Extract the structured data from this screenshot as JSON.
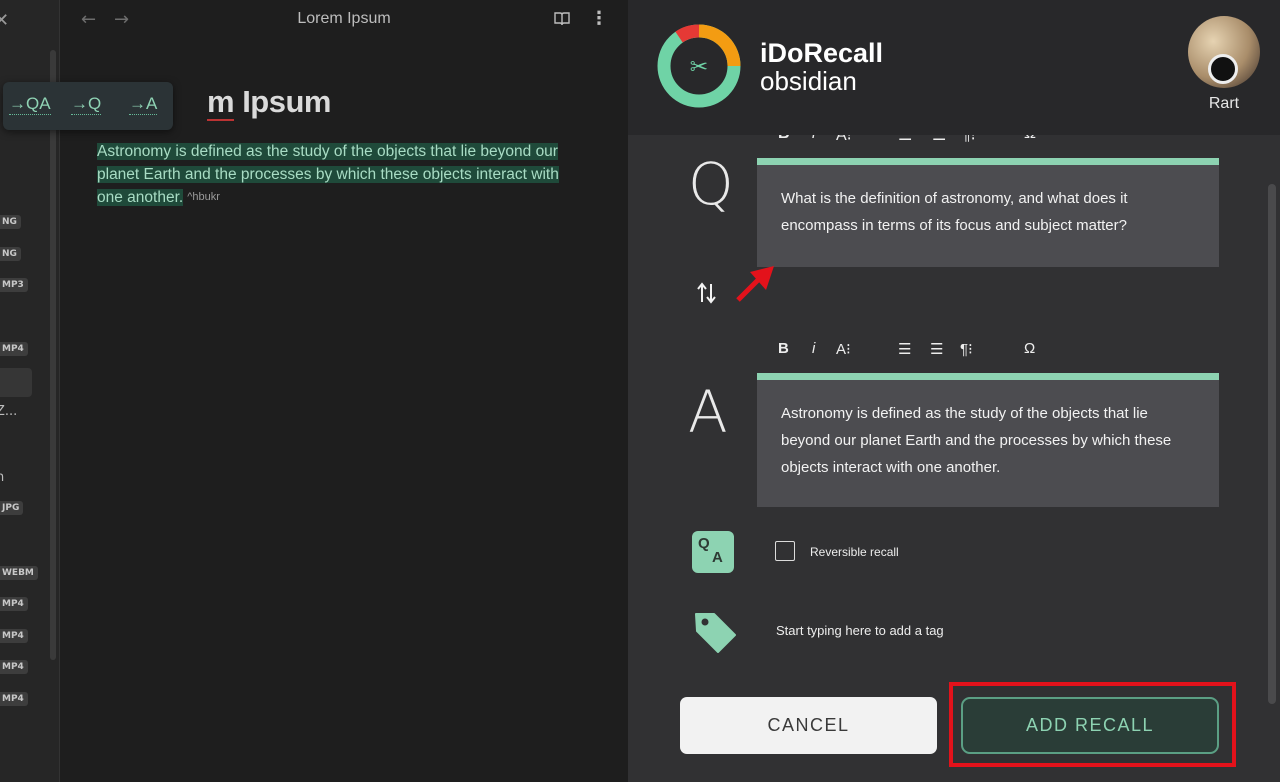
{
  "sidebar": {
    "close_glyph": "✕",
    "badges": [
      "NG",
      "NG",
      "MP3",
      "MP4",
      "MP4",
      "JPG",
      "WEBM",
      "MP4",
      "MP4",
      "MP4",
      "MP4"
    ],
    "texts": [
      "Z...",
      "n"
    ]
  },
  "editor": {
    "title": "Lorem Ipsum",
    "back_glyph": "←",
    "forward_glyph": "→",
    "more_glyph": "⋮",
    "heading_visible": "m Ipsum",
    "heading_squiggle": "m",
    "paragraph": "Astronomy is defined as the study of the objects that lie beyond our planet Earth and the processes by which these objects interact with one another.",
    "block_ref": "^hbukr",
    "popup_toolbar": {
      "qa_label": "→QA",
      "q_label": "→Q",
      "a_label": "→A"
    }
  },
  "panel": {
    "brand_title": "iDoRecall",
    "brand_subtitle": "obsidian",
    "user_name": "Rart",
    "question_letter": "Q",
    "answer_letter": "A",
    "question_text": "What is the definition of astronomy, and what does it encompass in terms of its focus and subject matter?",
    "answer_text": "Astronomy is defined as the study of the objects that lie beyond our planet Earth and the processes by which these objects interact with one another.",
    "format_toolbar": {
      "bold": "B",
      "italic": "i",
      "font_size": "A⁝",
      "align_left": "☰",
      "align_center": "☰",
      "paragraph": "¶⁝",
      "omega": "Ω"
    },
    "qa_icon_letters": {
      "q": "Q",
      "a": "A"
    },
    "reversible_label": "Reversible recall",
    "reversible_checked": false,
    "tag_placeholder": "Start typing here to add a tag",
    "cancel_label": "CANCEL",
    "add_label": "ADD RECALL"
  },
  "colors": {
    "accent_green": "#8dd3b2",
    "highlight_red": "#e3121b",
    "panel_bg": "#313133",
    "editor_bg": "#1e1e1e"
  }
}
